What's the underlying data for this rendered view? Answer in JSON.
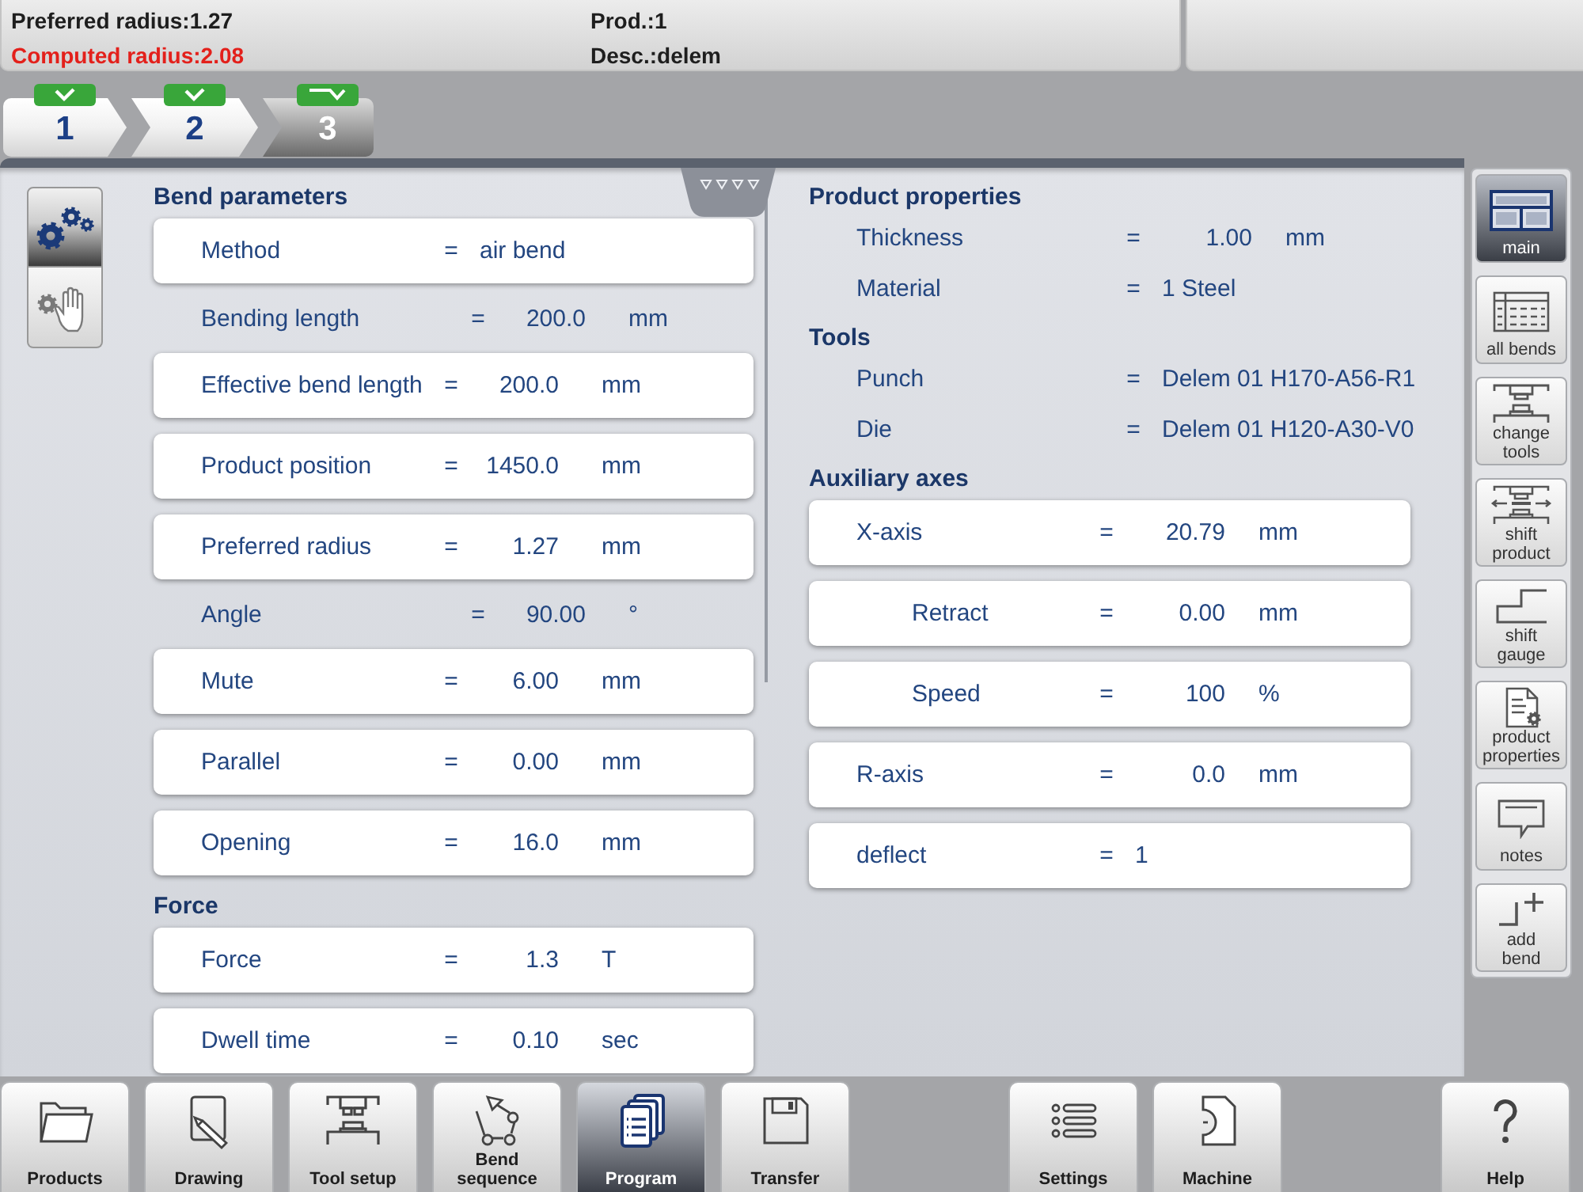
{
  "status_lines": [
    {
      "text": "Preferred radius:1.27",
      "alert": false
    },
    {
      "text": "Prod.:1",
      "alert": false
    },
    {
      "text": "Computed radius:2.08",
      "alert": true
    },
    {
      "text": "Desc.:delem",
      "alert": false
    }
  ],
  "steps": [
    {
      "label": "1",
      "selected": false,
      "complete": true
    },
    {
      "label": "2",
      "selected": false,
      "complete": true
    },
    {
      "label": "3",
      "selected": true,
      "complete": false
    }
  ],
  "view_tabs": [
    {
      "selected": true
    },
    {
      "selected": false
    }
  ],
  "left_sections": [
    {
      "title": "Bend parameters",
      "rows": [
        {
          "kind": "field",
          "label": "Method",
          "sign": "=",
          "value": "air bend"
        },
        {
          "kind": "info",
          "label": "Bending length",
          "sign": "=",
          "value": "200.0",
          "unit": "mm"
        },
        {
          "kind": "field",
          "label": "Effective bend length",
          "sign": "=",
          "value": "200.0",
          "unit": "mm"
        },
        {
          "kind": "field",
          "label": "Product position",
          "sign": "=",
          "value": "1450.0",
          "unit": "mm"
        },
        {
          "kind": "field",
          "label": "Preferred radius",
          "sign": "=",
          "value": "1.27",
          "unit": "mm"
        },
        {
          "kind": "info",
          "label": "Angle",
          "sign": "=",
          "value": "90.00",
          "unit": "°"
        },
        {
          "kind": "field",
          "label": "Mute",
          "sign": "=",
          "value": "6.00",
          "unit": "mm"
        },
        {
          "kind": "field",
          "label": "Parallel",
          "sign": "=",
          "value": "0.00",
          "unit": "mm"
        },
        {
          "kind": "field",
          "label": "Opening",
          "sign": "=",
          "value": "16.0",
          "unit": "mm"
        }
      ]
    },
    {
      "title": "Force",
      "rows": [
        {
          "kind": "field",
          "label": "Force",
          "sign": "=",
          "value": "1.3",
          "unit": "T"
        },
        {
          "kind": "field",
          "label": "Dwell time",
          "sign": "=",
          "value": "0.10",
          "unit": "sec"
        }
      ]
    }
  ],
  "right_sections": [
    {
      "title": "Product properties",
      "rows": [
        {
          "kind": "info",
          "label": "Thickness",
          "sign": "=",
          "value": "1.00",
          "unit": "mm"
        },
        {
          "kind": "info",
          "label": "Material",
          "sign": "=",
          "value": "1 Steel"
        }
      ]
    },
    {
      "title": "Tools",
      "rows": [
        {
          "kind": "info",
          "label": "Punch",
          "sign": "=",
          "value": "Delem 01 H170-A56-R1"
        },
        {
          "kind": "info",
          "label": "Die",
          "sign": "=",
          "value": "Delem 01 H120-A30-V0"
        }
      ]
    },
    {
      "title": "Auxiliary axes",
      "rows": [
        {
          "kind": "field",
          "label": "X-axis",
          "sign": "=",
          "value": "20.79",
          "unit": "mm",
          "children": [
            {
              "kind": "field",
              "label": "Retract",
              "sign": "=",
              "value": "0.00",
              "unit": "mm"
            },
            {
              "kind": "field",
              "label": "Speed",
              "sign": "=",
              "value": "100",
              "unit": "%"
            }
          ]
        },
        {
          "kind": "field",
          "label": "R-axis",
          "sign": "=",
          "value": "0.0",
          "unit": "mm"
        },
        {
          "kind": "field",
          "label": "deflect",
          "sign": "=",
          "value": "1"
        }
      ]
    }
  ],
  "sidebar": [
    {
      "label": "main",
      "selected": true
    },
    {
      "label": "all bends",
      "selected": false
    },
    {
      "label": "change tools",
      "selected": false
    },
    {
      "label": "shift product",
      "selected": false
    },
    {
      "label": "shift gauge",
      "selected": false
    },
    {
      "label": "product properties",
      "selected": false
    },
    {
      "label": "notes",
      "selected": false
    },
    {
      "label": "add bend",
      "selected": false
    }
  ],
  "toolbar": {
    "left": [
      {
        "label": "Products",
        "selected": false
      },
      {
        "label": "Drawing",
        "selected": false
      },
      {
        "label": "Tool setup",
        "selected": false
      },
      {
        "label": "Bend sequence",
        "selected": false
      },
      {
        "label": "Program",
        "selected": true
      },
      {
        "label": "Transfer",
        "selected": false
      }
    ],
    "middle": [
      {
        "label": "Settings",
        "selected": false
      },
      {
        "label": "Machine",
        "selected": false
      }
    ],
    "right": [
      {
        "label": "Help",
        "selected": false
      }
    ]
  }
}
